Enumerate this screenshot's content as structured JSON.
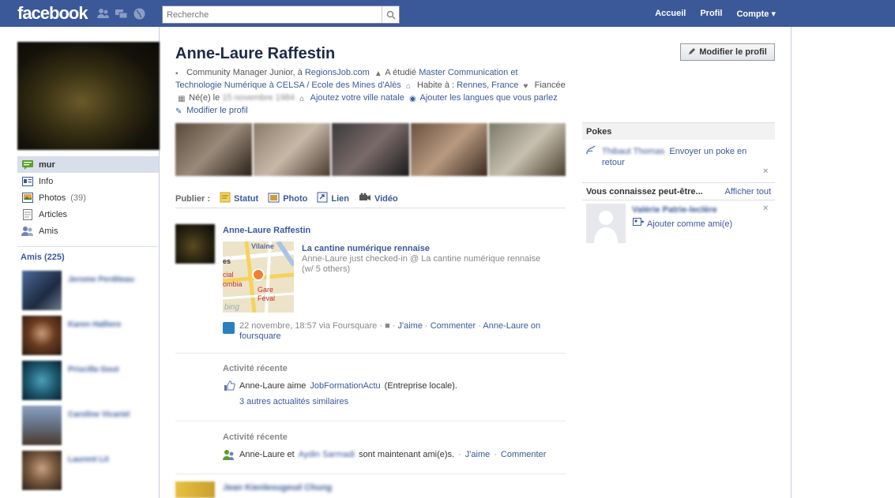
{
  "topbar": {
    "logo": "facebook",
    "search_placeholder": "Recherche",
    "nav": [
      "Accueil",
      "Profil",
      "Compte"
    ]
  },
  "sidebar": {
    "items": [
      {
        "label": "mur",
        "count": ""
      },
      {
        "label": "Info",
        "count": ""
      },
      {
        "label": "Photos",
        "count": "(39)"
      },
      {
        "label": "Articles",
        "count": ""
      },
      {
        "label": "Amis",
        "count": ""
      }
    ],
    "friends_title": "Amis (225)",
    "friends": [
      {
        "name": "Jerome Perditeau"
      },
      {
        "name": "Karen Halliere"
      },
      {
        "name": "Priscilla Gout"
      },
      {
        "name": "Caroline Vicariel"
      },
      {
        "name": "Laurent Lit"
      }
    ]
  },
  "profile": {
    "name": "Anne-Laure Raffestin",
    "edit_button": "Modifier le profil",
    "job_prefix": "Community Manager Junior, à",
    "job_company": "RegionsJob.com",
    "study_prefix": "A étudié",
    "study_school": "Master Communication et Technologie Numérique à CELSA / Ecole des Mines d'Alès",
    "lives_prefix": "Habite à :",
    "lives_city": "Rennes, France",
    "relationship": "Fiancée",
    "born_prefix": "Né(e) le",
    "born_date": "15 novembre 1984",
    "add_hometown": "Ajoutez votre ville natale",
    "add_languages": "Ajouter les langues que vous parlez",
    "edit_profile_link": "Modifier le profil"
  },
  "publisher": {
    "label": "Publier :",
    "items": [
      "Statut",
      "Photo",
      "Lien",
      "Vidéo"
    ]
  },
  "stories": {
    "checkin": {
      "author": "Anne-Laure Raffestin",
      "place": "La cantine numérique rennaise",
      "desc": "Anne-Laure just checked-in @ La cantine numérique rennaise (w/ 5 others)",
      "map_labels": [
        "Vilaine",
        "es",
        "cial",
        "ombia",
        "Gare",
        "Féval",
        "bing"
      ],
      "time": "22 novembre, 18:57 via Foursquare",
      "like": "J'aime",
      "comment": "Commenter",
      "extra_link": "Anne-Laure on foursquare"
    },
    "activity1": {
      "title": "Activité récente",
      "prefix": "Anne-Laure aime",
      "page": "JobFormationActu",
      "suffix": "(Entreprise locale).",
      "more": "3 autres actualités similaires"
    },
    "activity2": {
      "title": "Activité récente",
      "prefix": "Anne-Laure et",
      "friend": "Aydin Sarmadi",
      "suffix": "sont maintenant ami(e)s.",
      "like": "J'aime",
      "comment": "Commenter"
    },
    "next": {
      "author": "Jean Kienlesugeud Chung"
    }
  },
  "right": {
    "pokes_title": "Pokes",
    "poke_name": "Thibaut Thomas",
    "poke_action": "Envoyer un poke en retour",
    "pymk_title": "Vous connaissez peut-être...",
    "pymk_seeall": "Afficher tout",
    "pymk_name": "Valérie Patrie-leclère",
    "pymk_add": "Ajouter comme ami(e)"
  }
}
